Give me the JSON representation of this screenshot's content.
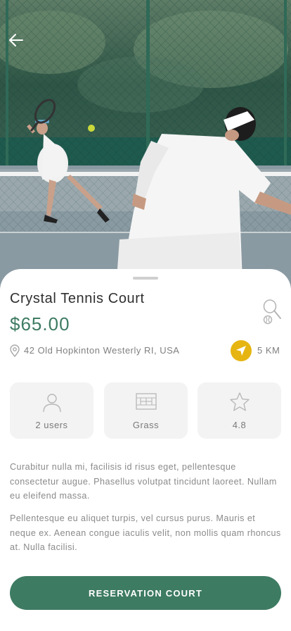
{
  "court": {
    "name": "Crystal Tennis Court",
    "price": "$65.00",
    "address": "42 Old Hopkinton Westerly RI, USA",
    "distance": "5 KM"
  },
  "stats": [
    {
      "label": "2 users",
      "icon": "user-icon"
    },
    {
      "label": "Grass",
      "icon": "court-icon"
    },
    {
      "label": "4.8",
      "icon": "star-icon"
    }
  ],
  "description": [
    "Curabitur nulla mi, facilisis id risus eget, pellentesque consectetur augue. Phasellus volutpat tincidunt laoreet. Nullam eu eleifend massa.",
    "Pellentesque eu aliquet turpis, vel cursus purus. Mauris et neque ex. Aenean congue iaculis velit, non mollis quam rhoncus at. Nulla facilisi."
  ],
  "cta_label": "RESERVATION COURT",
  "colors": {
    "accent": "#3e7b63",
    "location_badge": "#e6b512",
    "card_bg": "#f3f3f3",
    "text_dark": "#2f2f2f",
    "text_muted": "#8a8a8a"
  },
  "icons": {
    "back": "arrow-left-icon",
    "favorite": "racket-icon",
    "location": "map-pin-icon",
    "navigate": "navigation-arrow-icon"
  }
}
